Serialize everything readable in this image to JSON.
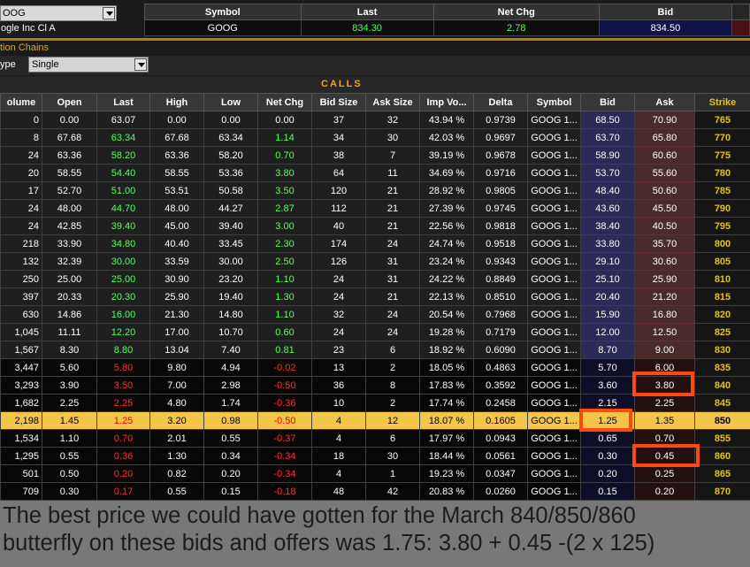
{
  "header": {
    "symbol_select": "OOG",
    "company_name": "ogle Inc Cl A",
    "quote_headers": [
      "Symbol",
      "Last",
      "Net Chg",
      "Bid"
    ],
    "quote": {
      "symbol": "GOOG",
      "last": "834.30",
      "net_chg": "2.78",
      "bid": "834.50"
    }
  },
  "chains": {
    "title": "tion Chains",
    "type_label": "ype",
    "type_value": "Single",
    "section": "CALLS"
  },
  "columns": [
    "olume",
    "Open",
    "Last",
    "High",
    "Low",
    "Net Chg",
    "Bid Size",
    "Ask Size",
    "Imp Vo...",
    "Delta",
    "Symbol",
    "Bid",
    "Ask",
    "Strike"
  ],
  "rows": [
    {
      "state": "itm",
      "last_dir": "none",
      "chg_dir": "none",
      "cells": [
        "0",
        "0.00",
        "63.07",
        "0.00",
        "0.00",
        "0.00",
        "37",
        "32",
        "43.94 %",
        "0.9739",
        "GOOG 1...",
        "68.50",
        "70.90",
        "765"
      ]
    },
    {
      "state": "itm",
      "last_dir": "pos",
      "chg_dir": "pos",
      "cells": [
        "8",
        "67.68",
        "63.34",
        "67.68",
        "63.34",
        "1.14",
        "34",
        "30",
        "42.03 %",
        "0.9697",
        "GOOG 1...",
        "63.70",
        "65.80",
        "770"
      ]
    },
    {
      "state": "itm",
      "last_dir": "pos",
      "chg_dir": "pos",
      "cells": [
        "24",
        "63.36",
        "58.20",
        "63.36",
        "58.20",
        "0.70",
        "38",
        "7",
        "39.19 %",
        "0.9678",
        "GOOG 1...",
        "58.90",
        "60.60",
        "775"
      ]
    },
    {
      "state": "itm",
      "last_dir": "pos",
      "chg_dir": "pos",
      "cells": [
        "20",
        "58.55",
        "54.40",
        "58.55",
        "53.36",
        "3.80",
        "64",
        "11",
        "34.69 %",
        "0.9716",
        "GOOG 1...",
        "53.70",
        "55.60",
        "780"
      ]
    },
    {
      "state": "itm",
      "last_dir": "pos",
      "chg_dir": "pos",
      "cells": [
        "17",
        "52.70",
        "51.00",
        "53.51",
        "50.58",
        "3.50",
        "120",
        "21",
        "28.92 %",
        "0.9805",
        "GOOG 1...",
        "48.40",
        "50.60",
        "785"
      ]
    },
    {
      "state": "itm",
      "last_dir": "pos",
      "chg_dir": "pos",
      "cells": [
        "24",
        "48.00",
        "44.70",
        "48.00",
        "44.27",
        "2.87",
        "112",
        "21",
        "27.39 %",
        "0.9745",
        "GOOG 1...",
        "43.60",
        "45.50",
        "790"
      ]
    },
    {
      "state": "itm",
      "last_dir": "pos",
      "chg_dir": "pos",
      "cells": [
        "24",
        "42.85",
        "39.40",
        "45.00",
        "39.40",
        "3.00",
        "40",
        "21",
        "22.56 %",
        "0.9818",
        "GOOG 1...",
        "38.40",
        "40.50",
        "795"
      ]
    },
    {
      "state": "itm",
      "last_dir": "pos",
      "chg_dir": "pos",
      "cells": [
        "218",
        "33.90",
        "34.80",
        "40.40",
        "33.45",
        "2.30",
        "174",
        "24",
        "24.74 %",
        "0.9518",
        "GOOG 1...",
        "33.80",
        "35.70",
        "800"
      ]
    },
    {
      "state": "itm",
      "last_dir": "pos",
      "chg_dir": "pos",
      "cells": [
        "132",
        "32.39",
        "30.00",
        "33.59",
        "30.00",
        "2.50",
        "126",
        "31",
        "23.24 %",
        "0.9343",
        "GOOG 1...",
        "29.10",
        "30.60",
        "805"
      ]
    },
    {
      "state": "itm",
      "last_dir": "pos",
      "chg_dir": "pos",
      "cells": [
        "250",
        "25.00",
        "25.00",
        "30.90",
        "23.20",
        "1.10",
        "24",
        "31",
        "24.22 %",
        "0.8849",
        "GOOG 1...",
        "25.10",
        "25.90",
        "810"
      ]
    },
    {
      "state": "itm",
      "last_dir": "pos",
      "chg_dir": "pos",
      "cells": [
        "397",
        "20.33",
        "20.30",
        "25.90",
        "19.40",
        "1.30",
        "24",
        "21",
        "22.13 %",
        "0.8510",
        "GOOG 1...",
        "20.40",
        "21.20",
        "815"
      ]
    },
    {
      "state": "itm",
      "last_dir": "pos",
      "chg_dir": "pos",
      "cells": [
        "630",
        "14.86",
        "16.00",
        "21.30",
        "14.80",
        "1.10",
        "32",
        "24",
        "20.54 %",
        "0.7968",
        "GOOG 1...",
        "15.90",
        "16.80",
        "820"
      ]
    },
    {
      "state": "itm",
      "last_dir": "pos",
      "chg_dir": "pos",
      "cells": [
        "1,045",
        "11.11",
        "12.20",
        "17.00",
        "10.70",
        "0.60",
        "24",
        "24",
        "19.28 %",
        "0.7179",
        "GOOG 1...",
        "12.00",
        "12.50",
        "825"
      ]
    },
    {
      "state": "itm",
      "last_dir": "pos",
      "chg_dir": "pos",
      "cells": [
        "1,567",
        "8.30",
        "8.80",
        "13.04",
        "7.40",
        "0.81",
        "23",
        "6",
        "18.92 %",
        "0.6090",
        "GOOG 1...",
        "8.70",
        "9.00",
        "830"
      ]
    },
    {
      "state": "otm",
      "last_dir": "neg",
      "chg_dir": "neg",
      "cells": [
        "3,447",
        "5.60",
        "5.80",
        "9.80",
        "4.94",
        "-0.02",
        "13",
        "2",
        "18.05 %",
        "0.4863",
        "GOOG 1...",
        "5.70",
        "6.00",
        "835"
      ]
    },
    {
      "state": "otm",
      "last_dir": "neg",
      "chg_dir": "neg",
      "cells": [
        "3,293",
        "3.90",
        "3.50",
        "7.00",
        "2.98",
        "-0.50",
        "36",
        "8",
        "17.83 %",
        "0.3592",
        "GOOG 1...",
        "3.60",
        "3.80",
        "840"
      ]
    },
    {
      "state": "otm",
      "last_dir": "neg",
      "chg_dir": "neg",
      "cells": [
        "1,682",
        "2.25",
        "2.25",
        "4.80",
        "1.74",
        "-0.36",
        "10",
        "2",
        "17.74 %",
        "0.2458",
        "GOOG 1...",
        "2.15",
        "2.25",
        "845"
      ]
    },
    {
      "state": "atm",
      "last_dir": "neg",
      "chg_dir": "neg",
      "cells": [
        "2,198",
        "1.45",
        "1.25",
        "3.20",
        "0.98",
        "-0.50",
        "4",
        "12",
        "18.07 %",
        "0.1605",
        "GOOG 1...",
        "1.25",
        "1.35",
        "850"
      ]
    },
    {
      "state": "otm",
      "last_dir": "neg",
      "chg_dir": "neg",
      "cells": [
        "1,534",
        "1.10",
        "0.70",
        "2.01",
        "0.55",
        "-0.37",
        "4",
        "6",
        "17.97 %",
        "0.0943",
        "GOOG 1...",
        "0.65",
        "0.70",
        "855"
      ]
    },
    {
      "state": "otm",
      "last_dir": "neg",
      "chg_dir": "neg",
      "cells": [
        "1,295",
        "0.55",
        "0.36",
        "1.30",
        "0.34",
        "-0.34",
        "18",
        "30",
        "18.44 %",
        "0.0561",
        "GOOG 1...",
        "0.30",
        "0.45",
        "860"
      ]
    },
    {
      "state": "otm",
      "last_dir": "neg",
      "chg_dir": "neg",
      "cells": [
        "501",
        "0.50",
        "0.20",
        "0.82",
        "0.20",
        "-0.34",
        "4",
        "1",
        "19.23 %",
        "0.0347",
        "GOOG 1...",
        "0.20",
        "0.25",
        "865"
      ]
    },
    {
      "state": "otm",
      "last_dir": "neg",
      "chg_dir": "neg",
      "cells": [
        "709",
        "0.30",
        "0.17",
        "0.55",
        "0.15",
        "-0.18",
        "48",
        "42",
        "20.83 %",
        "0.0260",
        "GOOG 1...",
        "0.15",
        "0.20",
        "870"
      ]
    }
  ],
  "caption": {
    "line1": "The best price we could have gotten for the March 840/850/860",
    "line2": "butterfly on these bids and offers was 1.75: 3.80 + 0.45 -(2 x 125)"
  },
  "colors": {
    "positive": "#5cff5c",
    "negative": "#ff3030",
    "strike": "#e5c31d",
    "atm_row": "#f3c64a",
    "highlight_box": "#ff4a0f",
    "caption_bg": "#787878"
  }
}
